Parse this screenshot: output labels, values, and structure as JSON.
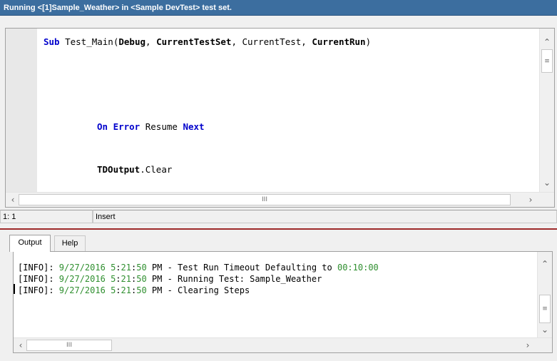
{
  "window": {
    "title": "Running <[1]Sample_Weather> in <Sample DevTest> test set."
  },
  "editor": {
    "lines": [
      [
        {
          "t": "Sub",
          "c": "kw"
        },
        {
          "t": " Test_Main(",
          "c": ""
        },
        {
          "t": "Debug",
          "c": "b"
        },
        {
          "t": ", ",
          "c": ""
        },
        {
          "t": "CurrentTestSet",
          "c": "b"
        },
        {
          "t": ", CurrentTest, ",
          "c": ""
        },
        {
          "t": "CurrentRun",
          "c": "b"
        },
        {
          "t": ")",
          "c": ""
        }
      ],
      [
        {
          "t": "On Error",
          "c": "kw"
        },
        {
          "t": " Resume ",
          "c": ""
        },
        {
          "t": "Next",
          "c": "kw"
        }
      ],
      [
        {
          "t": "TDOutput",
          "c": "b"
        },
        {
          "t": ".Clear",
          "c": ""
        }
      ]
    ],
    "hscroll_thumb_label": "III",
    "vscroll_thumb_label": "≡"
  },
  "status": {
    "position": "1: 1",
    "mode": "Insert"
  },
  "output": {
    "tabs": [
      {
        "label": "Output",
        "active": true
      },
      {
        "label": "Help",
        "active": false
      }
    ],
    "lines": [
      {
        "prefix": "[INFO]: ",
        "date": "9/27/2016",
        "time_h": "5",
        "time_m": "21",
        "time_s": "50",
        "msg_pre": " PM - Test Run Timeout Defaulting to ",
        "msg_val": "00:10:00"
      },
      {
        "prefix": "[INFO]: ",
        "date": "9/27/2016",
        "time_h": "5",
        "time_m": "21",
        "time_s": "50",
        "msg_pre": " PM - Running Test: Sample_Weather",
        "msg_val": ""
      },
      {
        "prefix": "[INFO]: ",
        "date": "9/27/2016",
        "time_h": "5",
        "time_m": "21",
        "time_s": "50",
        "msg_pre": " PM - Clearing Steps",
        "msg_val": ""
      }
    ],
    "hscroll_thumb_label": "III",
    "vscroll_thumb_label": "≡"
  }
}
